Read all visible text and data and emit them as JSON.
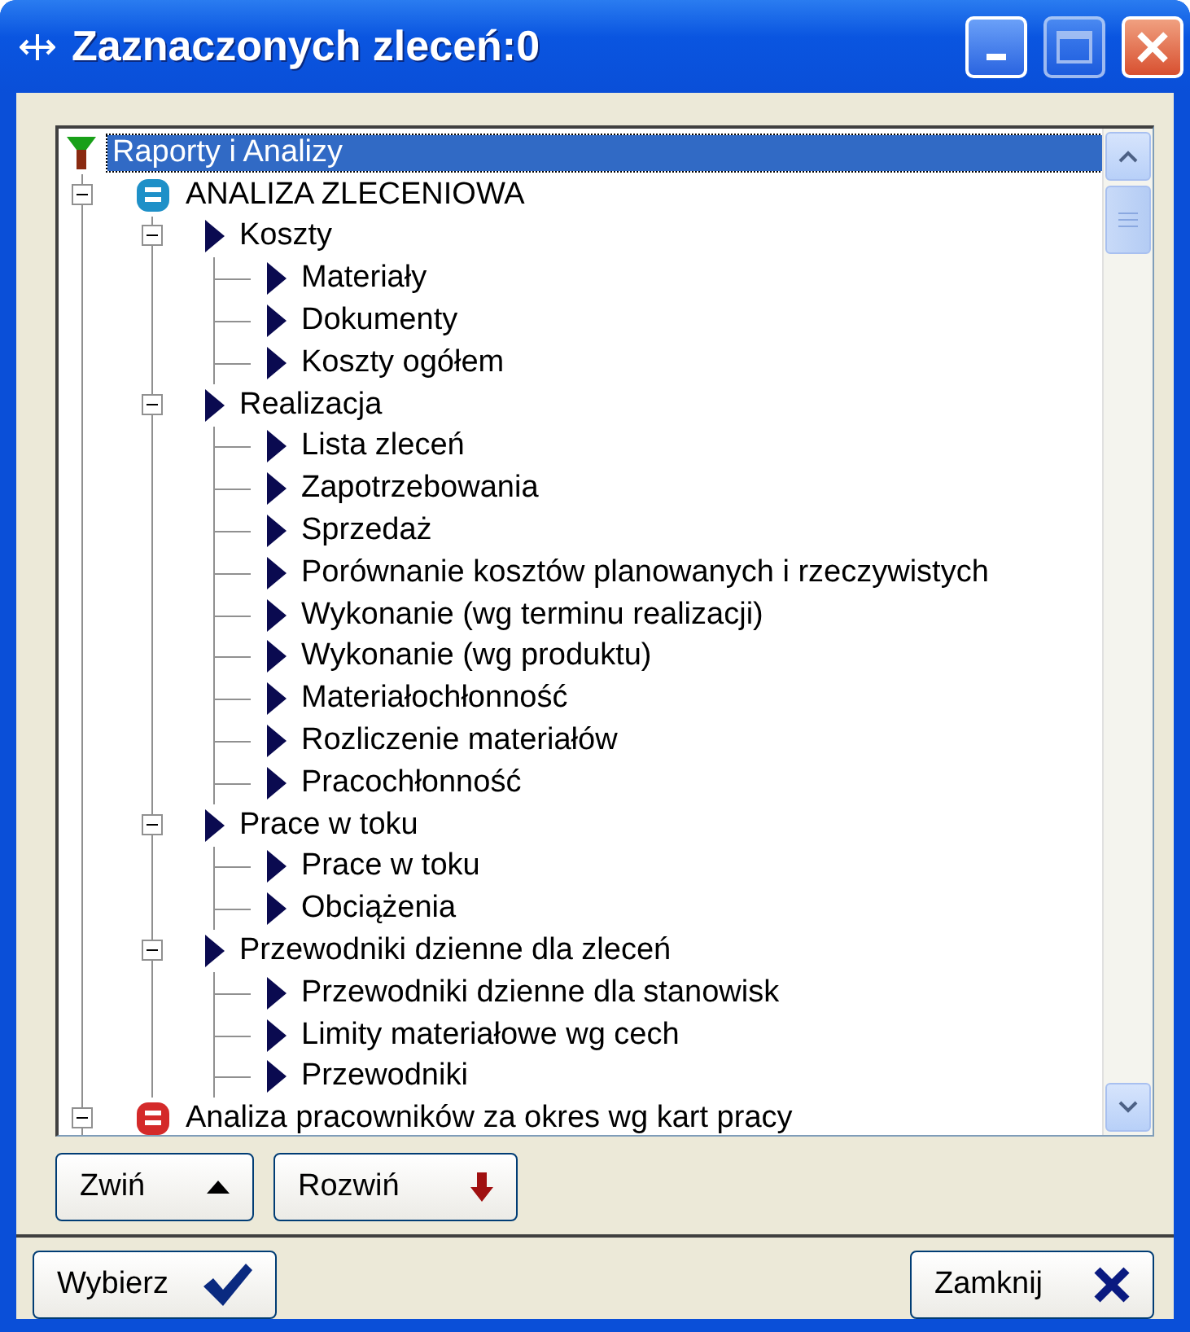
{
  "window": {
    "title": "Zaznaczonych zleceń:0"
  },
  "tree": [
    {
      "label": "Raporty i Analizy",
      "kind": "root",
      "selected": true,
      "children": [
        {
          "label": "ANALIZA ZLECENIOWA",
          "kind": "module",
          "color": "#1e90c8",
          "selected": false,
          "expanded": true,
          "children": [
            {
              "label": "Koszty",
              "kind": "report",
              "selected": false,
              "expanded": true,
              "children": [
                {
                  "label": "Materiały",
                  "kind": "report",
                  "selected": false
                },
                {
                  "label": "Dokumenty",
                  "kind": "report",
                  "selected": false
                },
                {
                  "label": "Koszty ogółem",
                  "kind": "report",
                  "selected": false
                }
              ]
            },
            {
              "label": "Realizacja",
              "kind": "report",
              "selected": false,
              "expanded": true,
              "children": [
                {
                  "label": "Lista zleceń",
                  "kind": "report",
                  "selected": false
                },
                {
                  "label": "Zapotrzebowania",
                  "kind": "report",
                  "selected": false
                },
                {
                  "label": "Sprzedaż",
                  "kind": "report",
                  "selected": false
                },
                {
                  "label": "Porównanie kosztów planowanych i rzeczywistych",
                  "kind": "report",
                  "selected": false
                },
                {
                  "label": "Wykonanie (wg terminu realizacji)",
                  "kind": "report",
                  "selected": false
                },
                {
                  "label": "Wykonanie (wg produktu)",
                  "kind": "report",
                  "selected": false
                },
                {
                  "label": "Materiałochłonność",
                  "kind": "report",
                  "selected": false
                },
                {
                  "label": "Rozliczenie materiałów",
                  "kind": "report",
                  "selected": false
                },
                {
                  "label": "Pracochłonność",
                  "kind": "report",
                  "selected": false
                }
              ]
            },
            {
              "label": "Prace w toku",
              "kind": "report",
              "selected": false,
              "expanded": true,
              "children": [
                {
                  "label": "Prace w toku",
                  "kind": "report",
                  "selected": false
                },
                {
                  "label": "Obciążenia",
                  "kind": "report",
                  "selected": false
                }
              ]
            },
            {
              "label": "Przewodniki dzienne dla zleceń",
              "kind": "report",
              "selected": false,
              "expanded": true,
              "children": [
                {
                  "label": "Przewodniki dzienne dla stanowisk",
                  "kind": "report",
                  "selected": false
                },
                {
                  "label": "Limity materiałowe wg cech",
                  "kind": "report",
                  "selected": false
                },
                {
                  "label": "Przewodniki",
                  "kind": "report",
                  "selected": false
                }
              ]
            }
          ]
        },
        {
          "label": "Analiza pracowników za okres wg kart pracy",
          "kind": "module",
          "color": "#d42a2a",
          "selected": false,
          "expanded": true
        }
      ]
    }
  ],
  "tree_buttons": [
    {
      "label": "Zwiń",
      "kind": "up"
    },
    {
      "label": "Rozwiń",
      "kind": "down"
    }
  ],
  "footer_buttons": [
    {
      "label": "Wybierz",
      "kind": "ok"
    },
    {
      "label": "Zamknij",
      "kind": "close"
    }
  ]
}
